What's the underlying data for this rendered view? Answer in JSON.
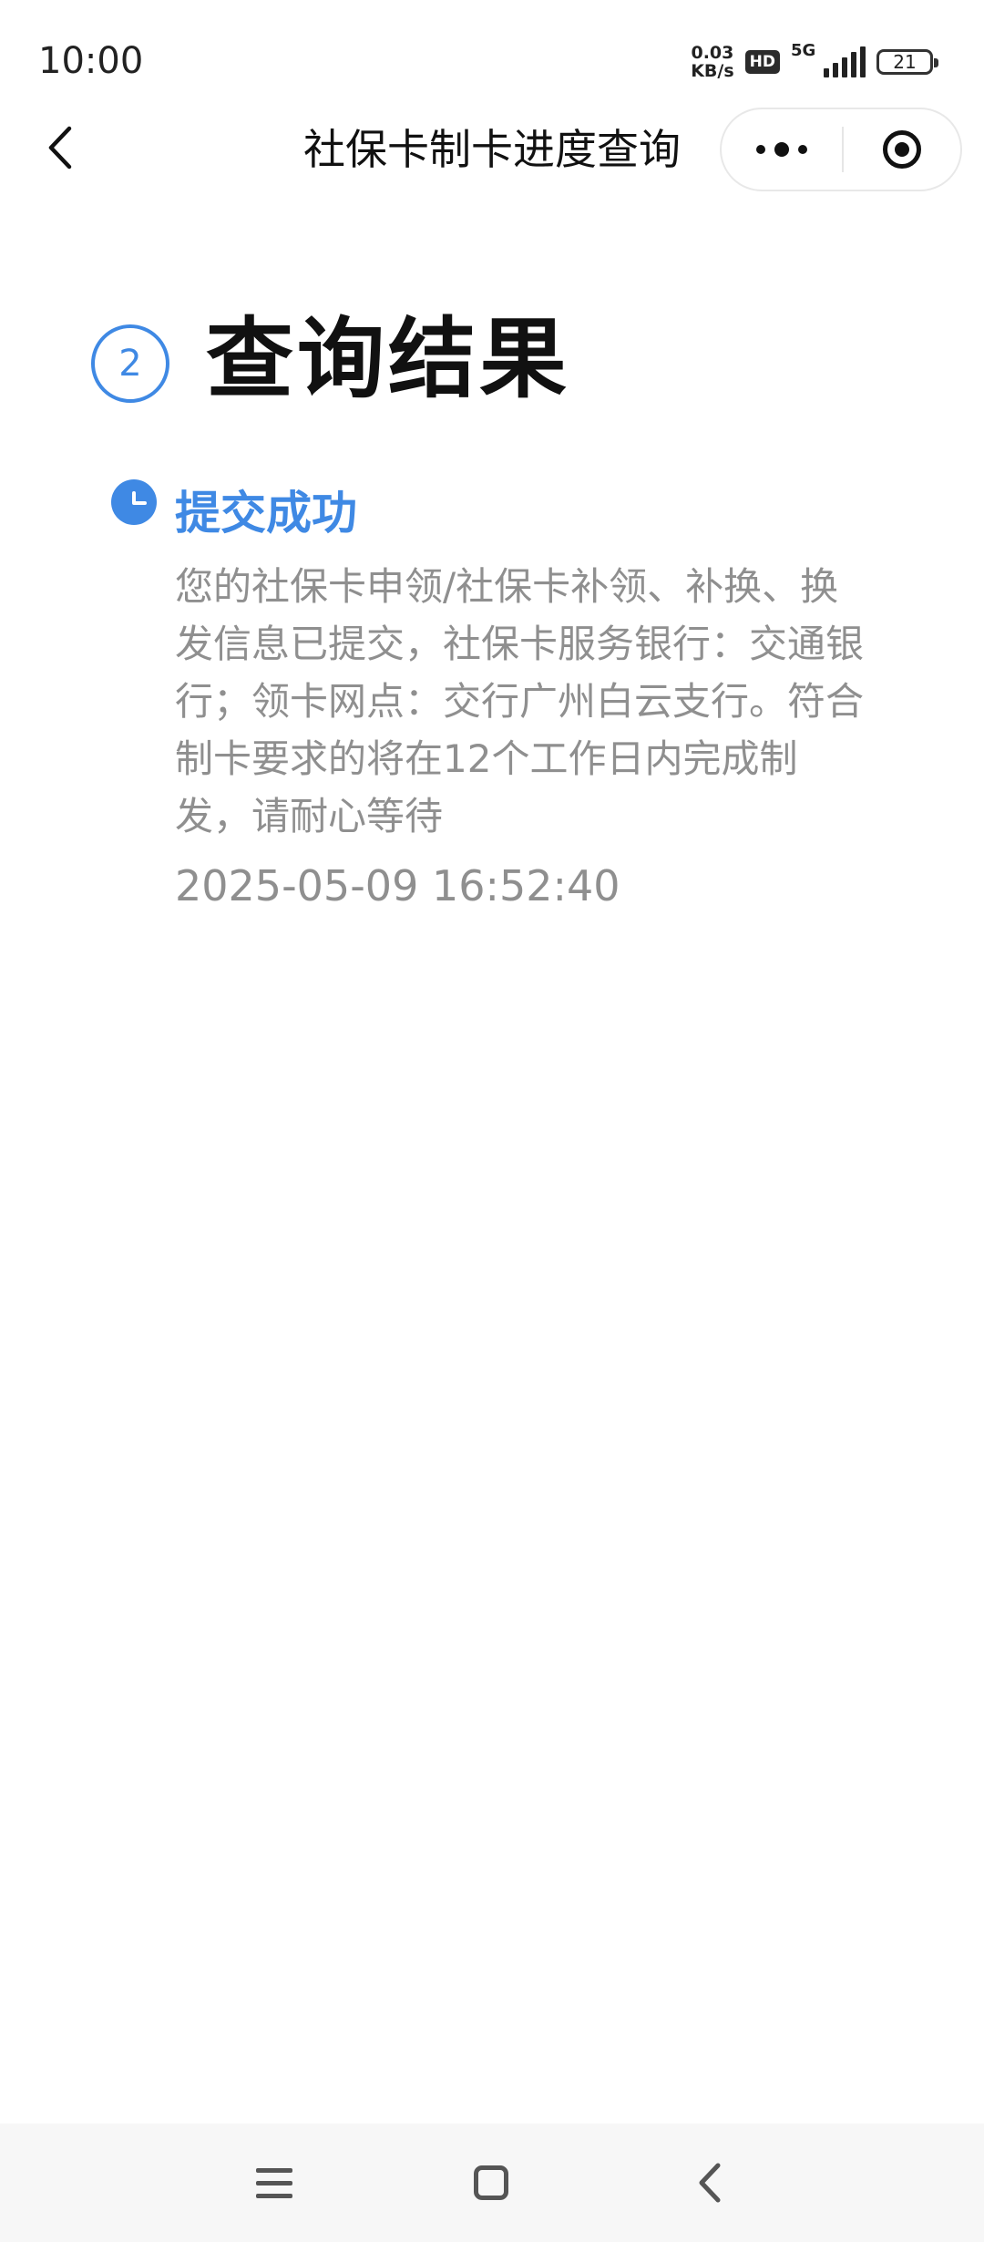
{
  "status_bar": {
    "time": "10:00",
    "net_speed_value": "0.03",
    "net_speed_unit": "KB/s",
    "hd_label": "HD",
    "network_label": "5G",
    "battery_level": "21",
    "icons": [
      "hd-icon",
      "signal-icon",
      "battery-icon"
    ]
  },
  "nav": {
    "title": "社保卡制卡进度查询",
    "back_icon": "chevron-left-icon",
    "more_icon": "more-dots-icon",
    "close_icon": "target-circle-icon"
  },
  "result": {
    "step_number": "2",
    "title": "查询结果"
  },
  "entry": {
    "icon": "clock-icon",
    "title": "提交成功",
    "description": "您的社保卡申领/社保卡补领、补换、换发信息已提交，社保卡服务银行：交通银行；领卡网点：交行广州白云支行。符合制卡要求的将在12个工作日内完成制发，请耐心等待",
    "timestamp": "2025-05-09 16:52:40"
  },
  "system_nav": {
    "icons": [
      "menu-icon",
      "home-icon",
      "back-icon"
    ]
  },
  "colors": {
    "accent": "#3f89e4",
    "muted_text": "#8f8f8f",
    "title_text": "#111111",
    "nav_background": "#f7f7f7"
  }
}
